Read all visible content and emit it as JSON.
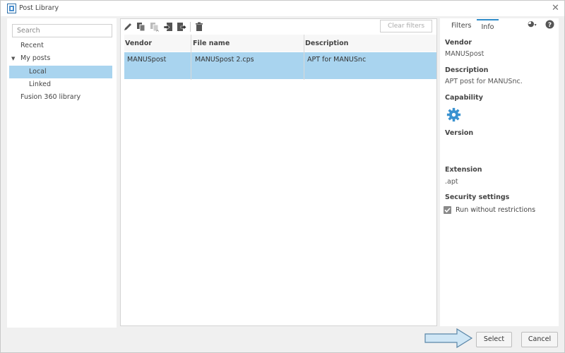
{
  "window": {
    "title": "Post Library"
  },
  "sidebar": {
    "search_placeholder": "Search",
    "items": [
      {
        "label": "Recent"
      },
      {
        "label": "My posts"
      },
      {
        "label": "Local",
        "selected": true
      },
      {
        "label": "Linked"
      },
      {
        "label": "Fusion 360 library"
      }
    ]
  },
  "toolbar": {
    "icons": [
      "edit-icon",
      "copy-icon",
      "paste-icon",
      "import-icon",
      "export-icon",
      "delete-icon"
    ],
    "clear_filters_label": "Clear filters"
  },
  "table": {
    "columns": [
      "Vendor",
      "File name",
      "Description"
    ],
    "rows": [
      {
        "vendor": "MANUSpost",
        "file_name": "MANUSpost 2.cps",
        "description": "APT for MANUSnc"
      }
    ]
  },
  "info_panel": {
    "tabs": [
      "Filters",
      "Info"
    ],
    "active_tab": "Info",
    "vendor_label": "Vendor",
    "vendor_value": "MANUSpost",
    "description_label": "Description",
    "description_value": "APT post for MANUSnc.",
    "capability_label": "Capability",
    "capability_icon": "gear-icon",
    "version_label": "Version",
    "extension_label": "Extension",
    "extension_value": ".apt",
    "security_label": "Security settings",
    "run_without_restrictions_label": "Run without restrictions",
    "run_without_restrictions_checked": true
  },
  "footer": {
    "select_label": "Select",
    "cancel_label": "Cancel"
  },
  "colors": {
    "selection": "#a9d4ef",
    "accent": "#2e8bc9",
    "gear": "#3a92d0",
    "arrow_fill": "#cfe6f5",
    "arrow_stroke": "#5a86a8"
  }
}
